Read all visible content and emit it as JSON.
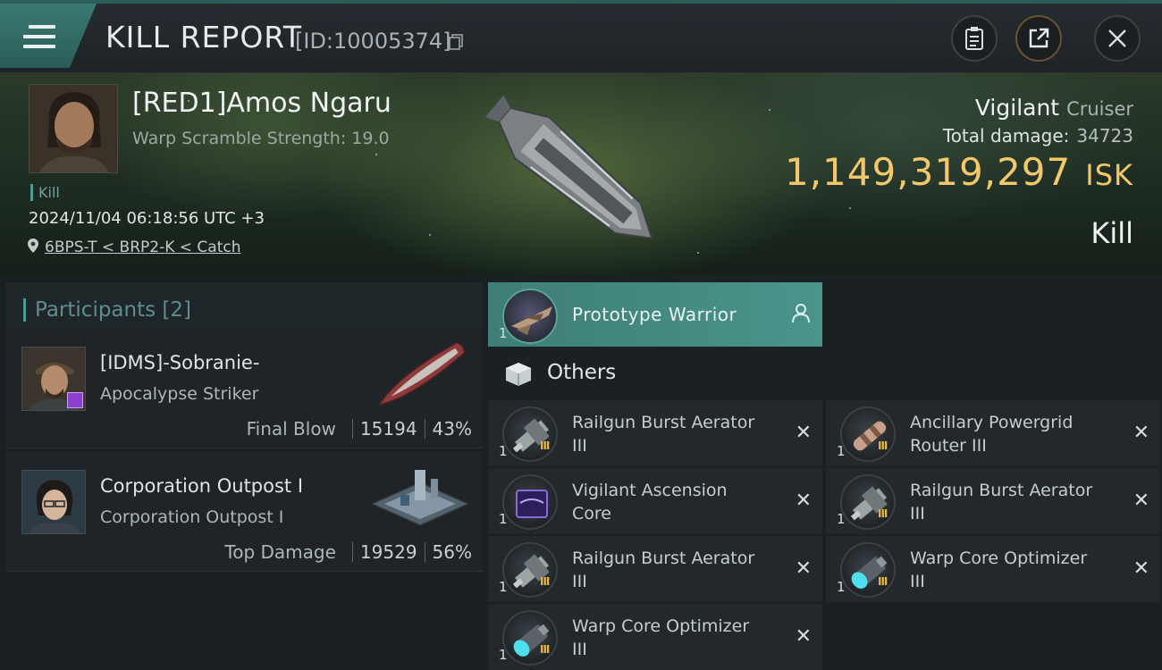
{
  "header": {
    "title": "KILL REPORT",
    "id_label": "[ID:10005374]"
  },
  "victim": {
    "name": "[RED1]Amos Ngaru",
    "warp_scramble": "Warp Scramble Strength: 19.0",
    "kill_tag": "Kill",
    "timestamp": "2024/11/04 06:18:56 UTC +3",
    "location": "6BPS-T < BRP2-K < Catch",
    "ship_name": "Vigilant",
    "ship_class": "Cruiser",
    "total_damage_label": "Total damage:",
    "total_damage": "34723",
    "isk_value": "1,149,319,297",
    "isk_unit": "ISK",
    "result": "Kill"
  },
  "participants": {
    "title": "Participants [2]",
    "list": [
      {
        "name": "[IDMS]-Sobranie-",
        "ship": "Apocalypse Striker",
        "stat_label": "Final Blow",
        "damage": "15194",
        "percent": "43%"
      },
      {
        "name": "Corporation Outpost I",
        "ship": "Corporation Outpost I",
        "stat_label": "Top Damage",
        "damage": "19529",
        "percent": "56%"
      }
    ]
  },
  "items": {
    "prototype": {
      "label": "Prototype  Warrior",
      "qty": "1"
    },
    "others_label": "Others",
    "list": [
      {
        "name_line1": "Railgun Burst Aerator",
        "name_line2": "III",
        "qty": "1",
        "tier": "III",
        "icon": "railgun-icon"
      },
      {
        "name_line1": "Ancillary Powergrid",
        "name_line2": "Router III",
        "qty": "1",
        "tier": "III",
        "icon": "powergrid-icon"
      },
      {
        "name_line1": "Vigilant Ascension",
        "name_line2": "Core",
        "qty": "1",
        "tier": "",
        "icon": "core-icon"
      },
      {
        "name_line1": "Railgun Burst Aerator",
        "name_line2": "III",
        "qty": "1",
        "tier": "III",
        "icon": "railgun-icon"
      },
      {
        "name_line1": "Railgun Burst Aerator",
        "name_line2": "III",
        "qty": "1",
        "tier": "III",
        "icon": "railgun-icon"
      },
      {
        "name_line1": "Warp Core Optimizer",
        "name_line2": "III",
        "qty": "1",
        "tier": "III",
        "icon": "warp-core-icon"
      },
      {
        "name_line1": "Warp Core Optimizer",
        "name_line2": "III",
        "qty": "1",
        "tier": "III",
        "icon": "warp-core-icon"
      }
    ]
  },
  "colors": {
    "accent": "#4a948b",
    "isk": "#f2c86a",
    "tier": "#e7b944"
  }
}
